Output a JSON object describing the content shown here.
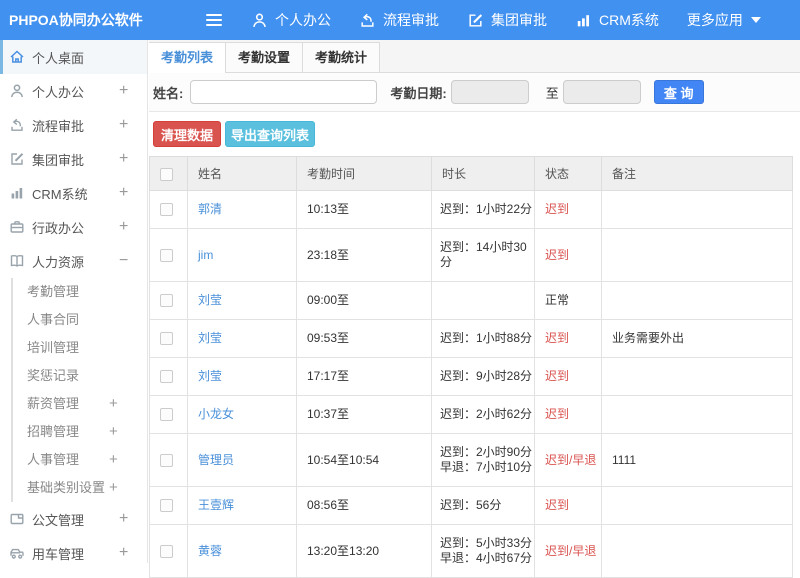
{
  "topbar": {
    "logo": "PHPOA协同办公软件",
    "nav": [
      {
        "key": "personal-office",
        "label": "个人办公",
        "icon": "user"
      },
      {
        "key": "workflow-approval",
        "label": "流程审批",
        "icon": "flow"
      },
      {
        "key": "group-approval",
        "label": "集团审批",
        "icon": "edit"
      },
      {
        "key": "crm-system",
        "label": "CRM系统",
        "icon": "chart"
      },
      {
        "key": "more-apps",
        "label": "更多应用",
        "icon": "",
        "caret": true
      }
    ]
  },
  "sidebar": {
    "items": [
      {
        "key": "personal-desktop",
        "label": "个人桌面",
        "icon": "home",
        "active": true
      },
      {
        "key": "personal-office",
        "label": "个人办公",
        "icon": "user",
        "expand": "+"
      },
      {
        "key": "workflow-approval",
        "label": "流程审批",
        "icon": "flow",
        "expand": "+"
      },
      {
        "key": "group-approval",
        "label": "集团审批",
        "icon": "edit",
        "expand": "+"
      },
      {
        "key": "crm-system",
        "label": "CRM系统",
        "icon": "chart",
        "expand": "+"
      },
      {
        "key": "admin-office",
        "label": "行政办公",
        "icon": "briefcase",
        "expand": "+"
      },
      {
        "key": "human-resources",
        "label": "人力资源",
        "icon": "book",
        "expand": "−",
        "children": [
          {
            "key": "attendance-management",
            "label": "考勤管理"
          },
          {
            "key": "personnel-contract",
            "label": "人事合同"
          },
          {
            "key": "training-management",
            "label": "培训管理"
          },
          {
            "key": "reward-punishment",
            "label": "奖惩记录"
          },
          {
            "key": "salary-management",
            "label": "薪资管理",
            "expand": "+"
          },
          {
            "key": "recruitment-management",
            "label": "招聘管理",
            "expand": "+"
          },
          {
            "key": "personnel-management",
            "label": "人事管理",
            "expand": "+"
          },
          {
            "key": "basic-category-settings",
            "label": "基础类别设置",
            "expand": "+"
          }
        ]
      },
      {
        "key": "document-management",
        "label": "公文管理",
        "icon": "doc",
        "expand": "+"
      },
      {
        "key": "vehicle-management",
        "label": "用车管理",
        "icon": "car",
        "expand": "+"
      }
    ]
  },
  "tabs": [
    {
      "key": "attendance-list",
      "label": "考勤列表",
      "active": true
    },
    {
      "key": "attendance-settings",
      "label": "考勤设置",
      "active": false
    },
    {
      "key": "attendance-statistics",
      "label": "考勤统计",
      "active": false
    }
  ],
  "filter": {
    "name_label": "姓名:",
    "date_label": "考勤日期:",
    "to_label": "至",
    "search_button": "查 询"
  },
  "actions": {
    "clear_button": "清理数据",
    "export_button": "导出查询列表"
  },
  "table": {
    "headers": [
      "姓名",
      "考勤时间",
      "时长",
      "状态",
      "备注"
    ],
    "rows": [
      {
        "name": "郭清",
        "time": "10:13至",
        "duration": [
          "迟到：1小时22分"
        ],
        "status": "迟到",
        "late": true,
        "note": ""
      },
      {
        "name": "jim",
        "time": "23:18至",
        "duration": [
          "迟到：14小时30分"
        ],
        "status": "迟到",
        "late": true,
        "note": ""
      },
      {
        "name": "刘莹",
        "time": "09:00至",
        "duration": [],
        "status": "正常",
        "late": false,
        "note": ""
      },
      {
        "name": "刘莹",
        "time": "09:53至",
        "duration": [
          "迟到：1小时88分"
        ],
        "status": "迟到",
        "late": true,
        "note": "业务需要外出"
      },
      {
        "name": "刘莹",
        "time": "17:17至",
        "duration": [
          "迟到：9小时28分"
        ],
        "status": "迟到",
        "late": true,
        "note": ""
      },
      {
        "name": "小龙女",
        "time": "10:37至",
        "duration": [
          "迟到：2小时62分"
        ],
        "status": "迟到",
        "late": true,
        "note": ""
      },
      {
        "name": "管理员",
        "time": "10:54至10:54",
        "duration": [
          "迟到：2小时90分",
          "早退：7小时10分"
        ],
        "status": "迟到/早退",
        "late": true,
        "note": "1111"
      },
      {
        "name": "王壹辉",
        "time": "08:56至",
        "duration": [
          "迟到：56分"
        ],
        "status": "迟到",
        "late": true,
        "note": ""
      },
      {
        "name": "黄蓉",
        "time": "13:20至13:20",
        "duration": [
          "迟到：5小时33分",
          "早退：4小时67分"
        ],
        "status": "迟到/早退",
        "late": true,
        "note": ""
      }
    ]
  }
}
